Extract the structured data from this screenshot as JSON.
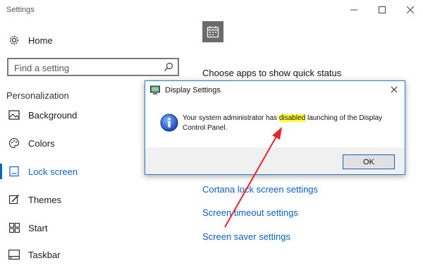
{
  "window": {
    "title": "Settings"
  },
  "sidebar": {
    "home_label": "Home",
    "search_placeholder": "Find a setting",
    "section_heading": "Personalization",
    "items": [
      {
        "label": "Background",
        "icon": "picture-icon"
      },
      {
        "label": "Colors",
        "icon": "palette-icon"
      },
      {
        "label": "Lock screen",
        "icon": "lock-screen-icon",
        "active": true
      },
      {
        "label": "Themes",
        "icon": "brush-icon"
      },
      {
        "label": "Start",
        "icon": "start-grid-icon"
      },
      {
        "label": "Taskbar",
        "icon": "taskbar-icon"
      }
    ]
  },
  "main": {
    "choose_apps": "Choose apps to show quick status",
    "links": [
      "Cortana lock screen settings",
      "Screen timeout settings",
      "Screen saver settings"
    ]
  },
  "dialog": {
    "title": "Display Settings",
    "message_before": "Your system administrator has ",
    "message_highlight": "disabled",
    "message_after": " launching of the Display Control Panel.",
    "ok_label": "OK"
  },
  "colors": {
    "accent": "#0a64c8",
    "link": "#0a5fbf",
    "highlight": "#ffff3a",
    "annotation_arrow": "#e8232a"
  }
}
